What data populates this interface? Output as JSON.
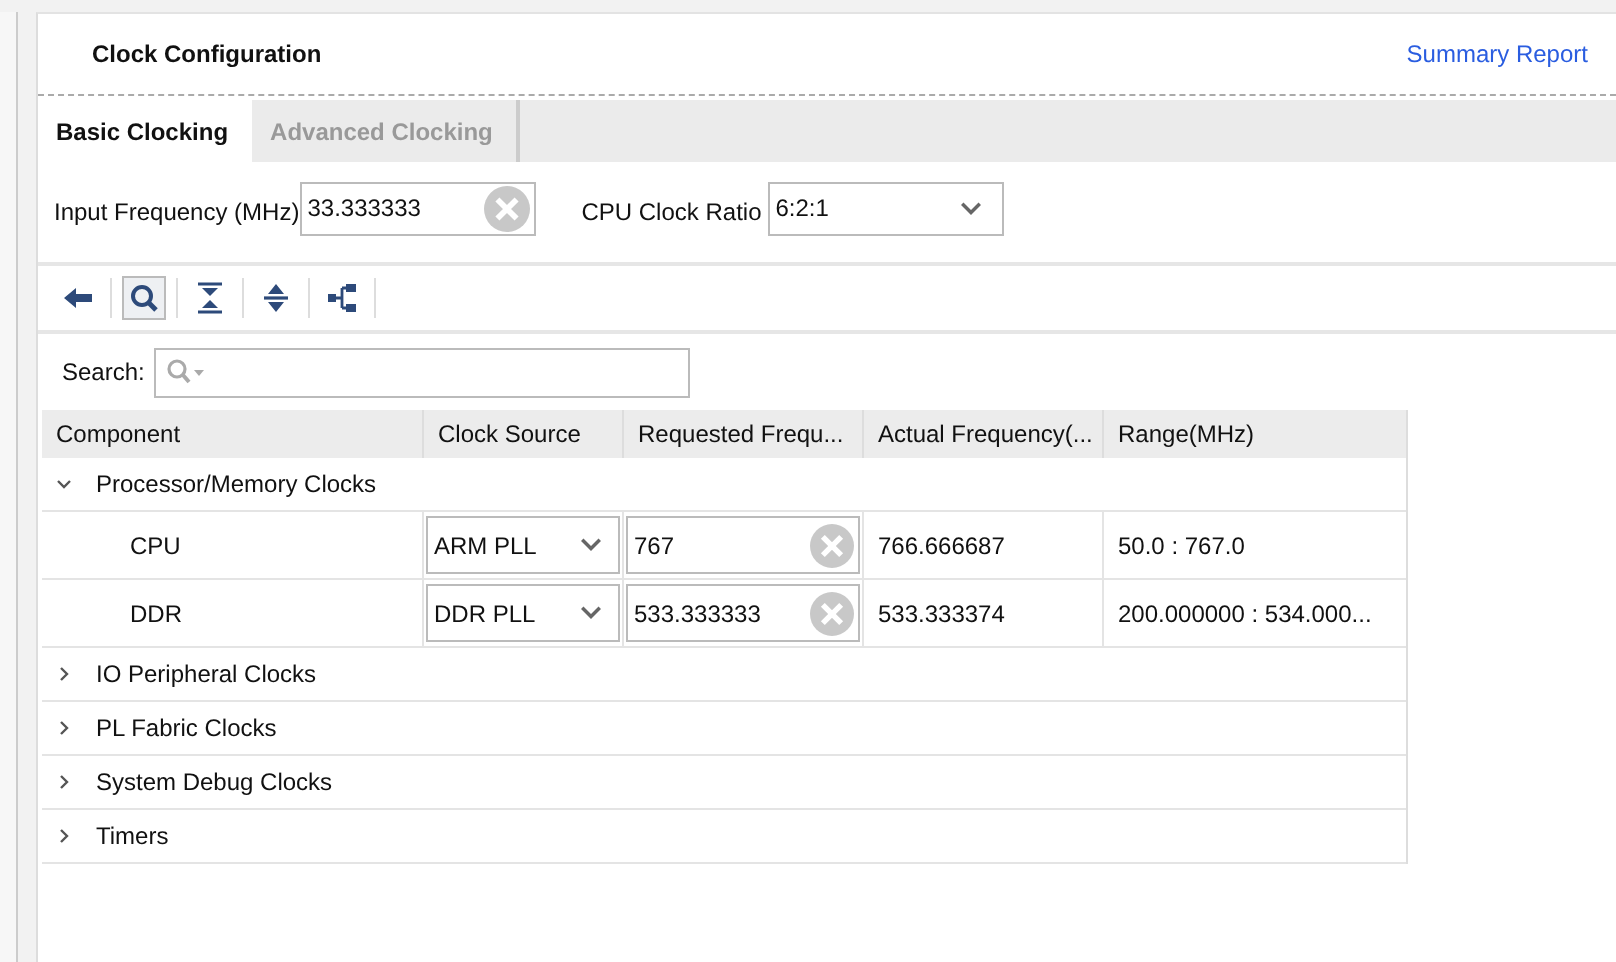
{
  "header": {
    "title": "Clock Configuration",
    "link": "Summary Report"
  },
  "tabs": [
    {
      "label": "Basic Clocking",
      "selected": true
    },
    {
      "label": "Advanced Clocking",
      "selected": false
    }
  ],
  "input_frequency": {
    "label": "Input Frequency (MHz)",
    "value": "33.333333"
  },
  "cpu_clock_ratio": {
    "label": "CPU Clock Ratio",
    "value": "6:2:1"
  },
  "toolbar": [
    {
      "kind": "back",
      "pressed": false
    },
    {
      "kind": "search",
      "pressed": true
    },
    {
      "kind": "collapse",
      "pressed": false
    },
    {
      "kind": "expand",
      "pressed": false
    },
    {
      "kind": "hierarchy",
      "pressed": false
    }
  ],
  "search": {
    "label": "Search:"
  },
  "table": {
    "columns": [
      "Component",
      "Clock Source",
      "Requested Frequ...",
      "Actual Frequency(...",
      "Range(MHz)"
    ],
    "groups": [
      {
        "label": "Processor/Memory Clocks",
        "expanded": true,
        "children": [
          {
            "component": "CPU",
            "clock_source": "ARM PLL",
            "requested": "767",
            "actual": "766.666687",
            "range": "50.0 : 767.0"
          },
          {
            "component": "DDR",
            "clock_source": "DDR PLL",
            "requested": "533.333333",
            "actual": "533.333374",
            "range": "200.000000 : 534.000..."
          }
        ]
      },
      {
        "label": "IO Peripheral Clocks",
        "expanded": false
      },
      {
        "label": "PL Fabric Clocks",
        "expanded": false
      },
      {
        "label": "System Debug Clocks",
        "expanded": false
      },
      {
        "label": "Timers",
        "expanded": false
      }
    ]
  }
}
